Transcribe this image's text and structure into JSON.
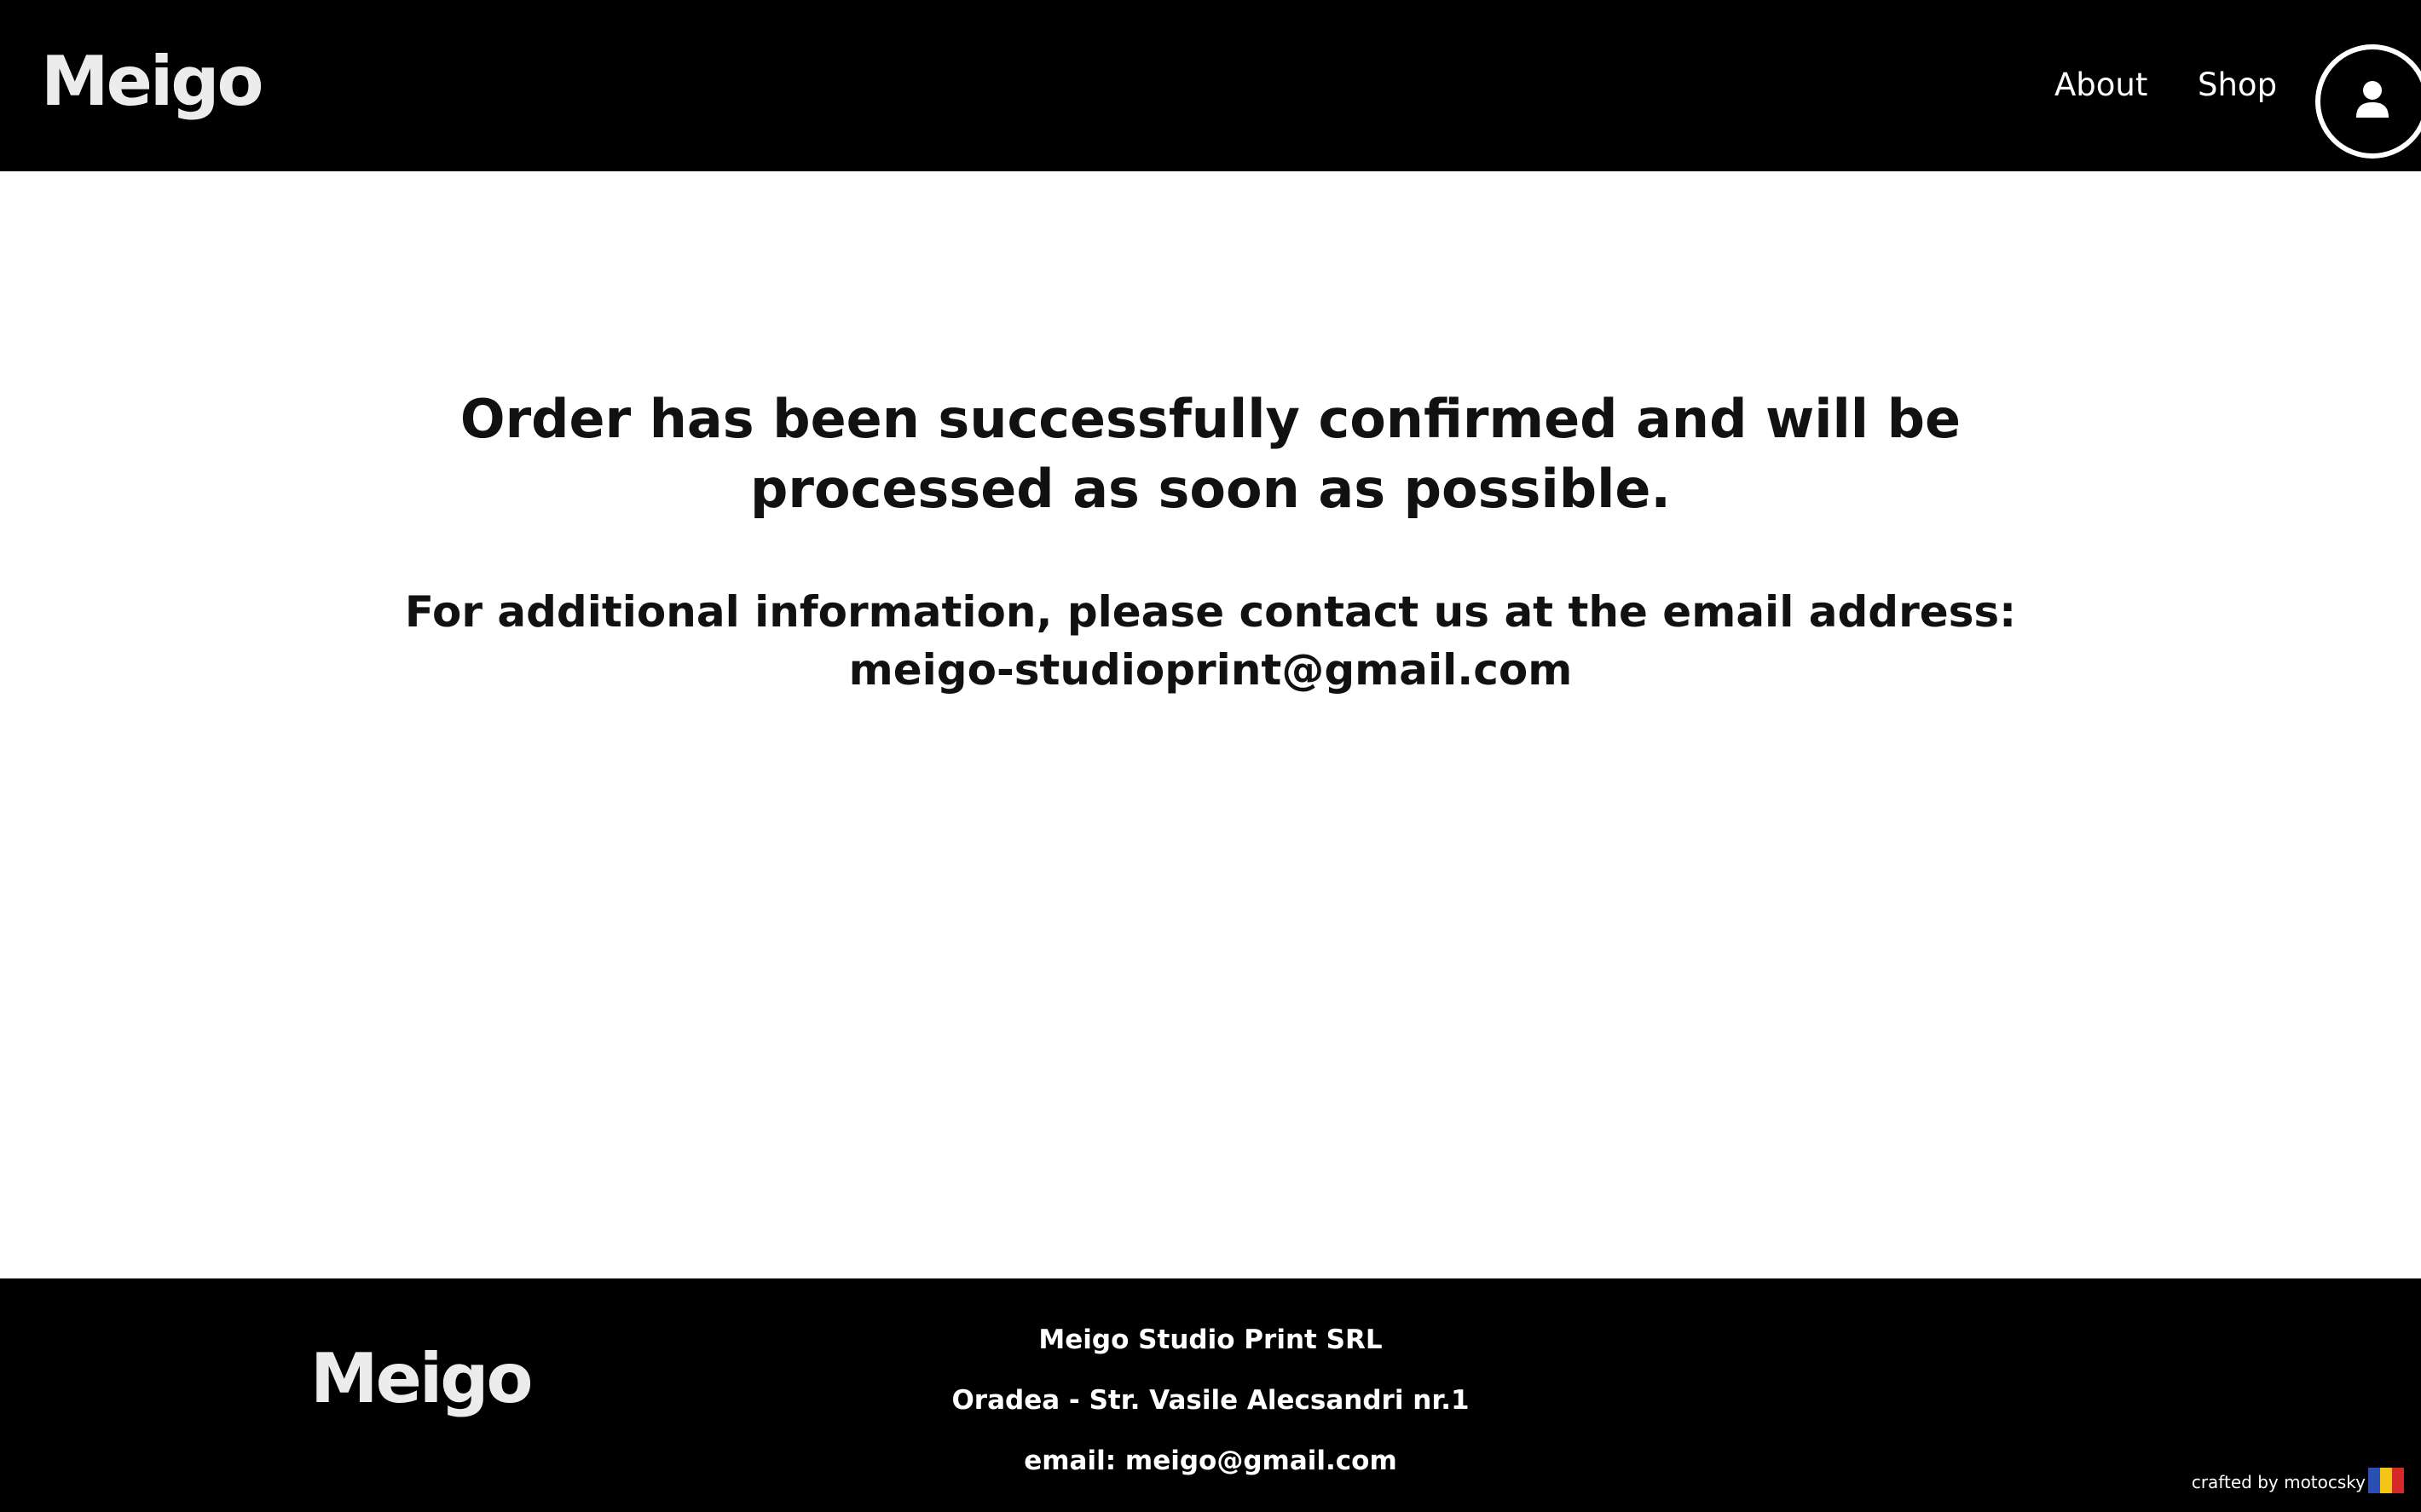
{
  "header": {
    "logo_text": "Meigo",
    "nav": {
      "about": "About",
      "shop": "Shop"
    },
    "account_icon": "user-circle-icon"
  },
  "main": {
    "headline": "Order has been successfully confirmed and will be processed as soon as possible.",
    "contact_text": "For additional information, please contact us at the email address: meigo-studioprint@gmail.com"
  },
  "footer": {
    "logo_text": "Meigo",
    "company": "Meigo Studio Print SRL",
    "address": "Oradea - Str. Vasile Alecsandri nr.1",
    "email": "email: meigo@gmail.com",
    "credit": "crafted by motocsky",
    "flag_colors": [
      "#2b4fb3",
      "#f5c518",
      "#d62828"
    ]
  },
  "colors": {
    "bar_background": "#000000",
    "page_background": "#ffffff",
    "text_dark": "#111111",
    "logo": "#ececec"
  }
}
